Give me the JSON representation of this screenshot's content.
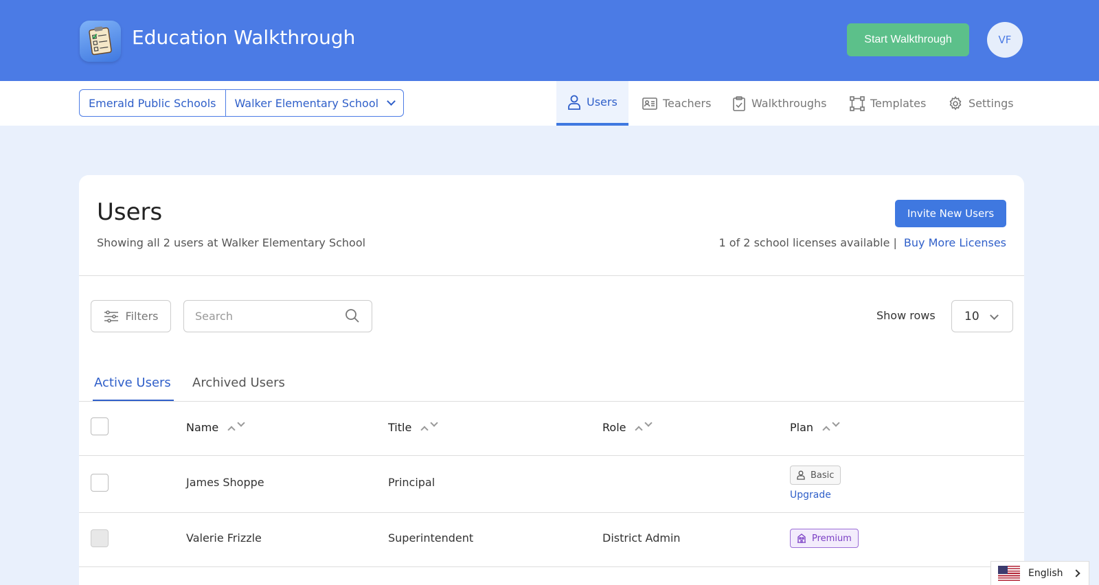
{
  "app": {
    "title": "Education Walkthrough",
    "start_label": "Start Walkthrough",
    "avatar_initials": "VF"
  },
  "district_select": {
    "district": "Emerald Public Schools",
    "school": "Walker Elementary School"
  },
  "nav": {
    "users": "Users",
    "teachers": "Teachers",
    "walkthroughs": "Walkthroughs",
    "templates": "Templates",
    "settings": "Settings",
    "active": "users"
  },
  "page": {
    "title": "Users",
    "subtitle": "Showing all 2 users at Walker Elementary School",
    "invite_label": "Invite New Users",
    "licenses_text": "1 of 2 school licenses available |",
    "buy_label": "Buy More Licenses"
  },
  "toolbar": {
    "filters_label": "Filters",
    "search_placeholder": "Search",
    "show_rows_label": "Show rows",
    "rows_value": "10"
  },
  "tabs": {
    "active_label": "Active Users",
    "archived_label": "Archived Users"
  },
  "table": {
    "columns": [
      "Name",
      "Title",
      "Role",
      "Plan"
    ],
    "rows": [
      {
        "name": "James Shoppe",
        "title": "Principal",
        "role": "",
        "plan": "Basic",
        "action": "Upgrade"
      },
      {
        "name": "Valerie Frizzle",
        "title": "Superintendent",
        "role": "District Admin",
        "plan": "Premium"
      }
    ]
  },
  "language": {
    "label": "English"
  },
  "colors": {
    "header": "#4b7be5",
    "accent": "#3f78e0",
    "start_button": "#5cc08a",
    "premium": "#7b3fc4"
  }
}
